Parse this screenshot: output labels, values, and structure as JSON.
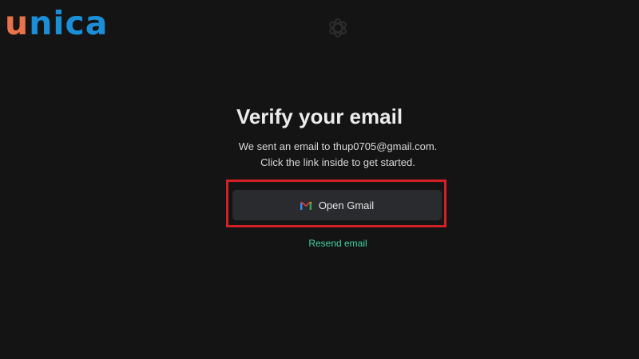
{
  "watermark": {
    "logo_first": "u",
    "logo_rest": "nica",
    "logo_colors": {
      "first": "#e8734a",
      "rest": "#1a8fd8"
    }
  },
  "brand_icon": "openai-logo-icon",
  "verify": {
    "title": "Verify your email",
    "line1": "We sent an email to thup0705@gmail.com.",
    "line2": "Click the link inside to get started.",
    "open_gmail_label": "Open Gmail",
    "open_gmail_icon": "gmail-icon",
    "resend_label": "Resend email"
  },
  "colors": {
    "background": "#141414",
    "button_bg": "#2a2b2e",
    "highlight": "#d31f26",
    "link": "#3fd39d"
  }
}
